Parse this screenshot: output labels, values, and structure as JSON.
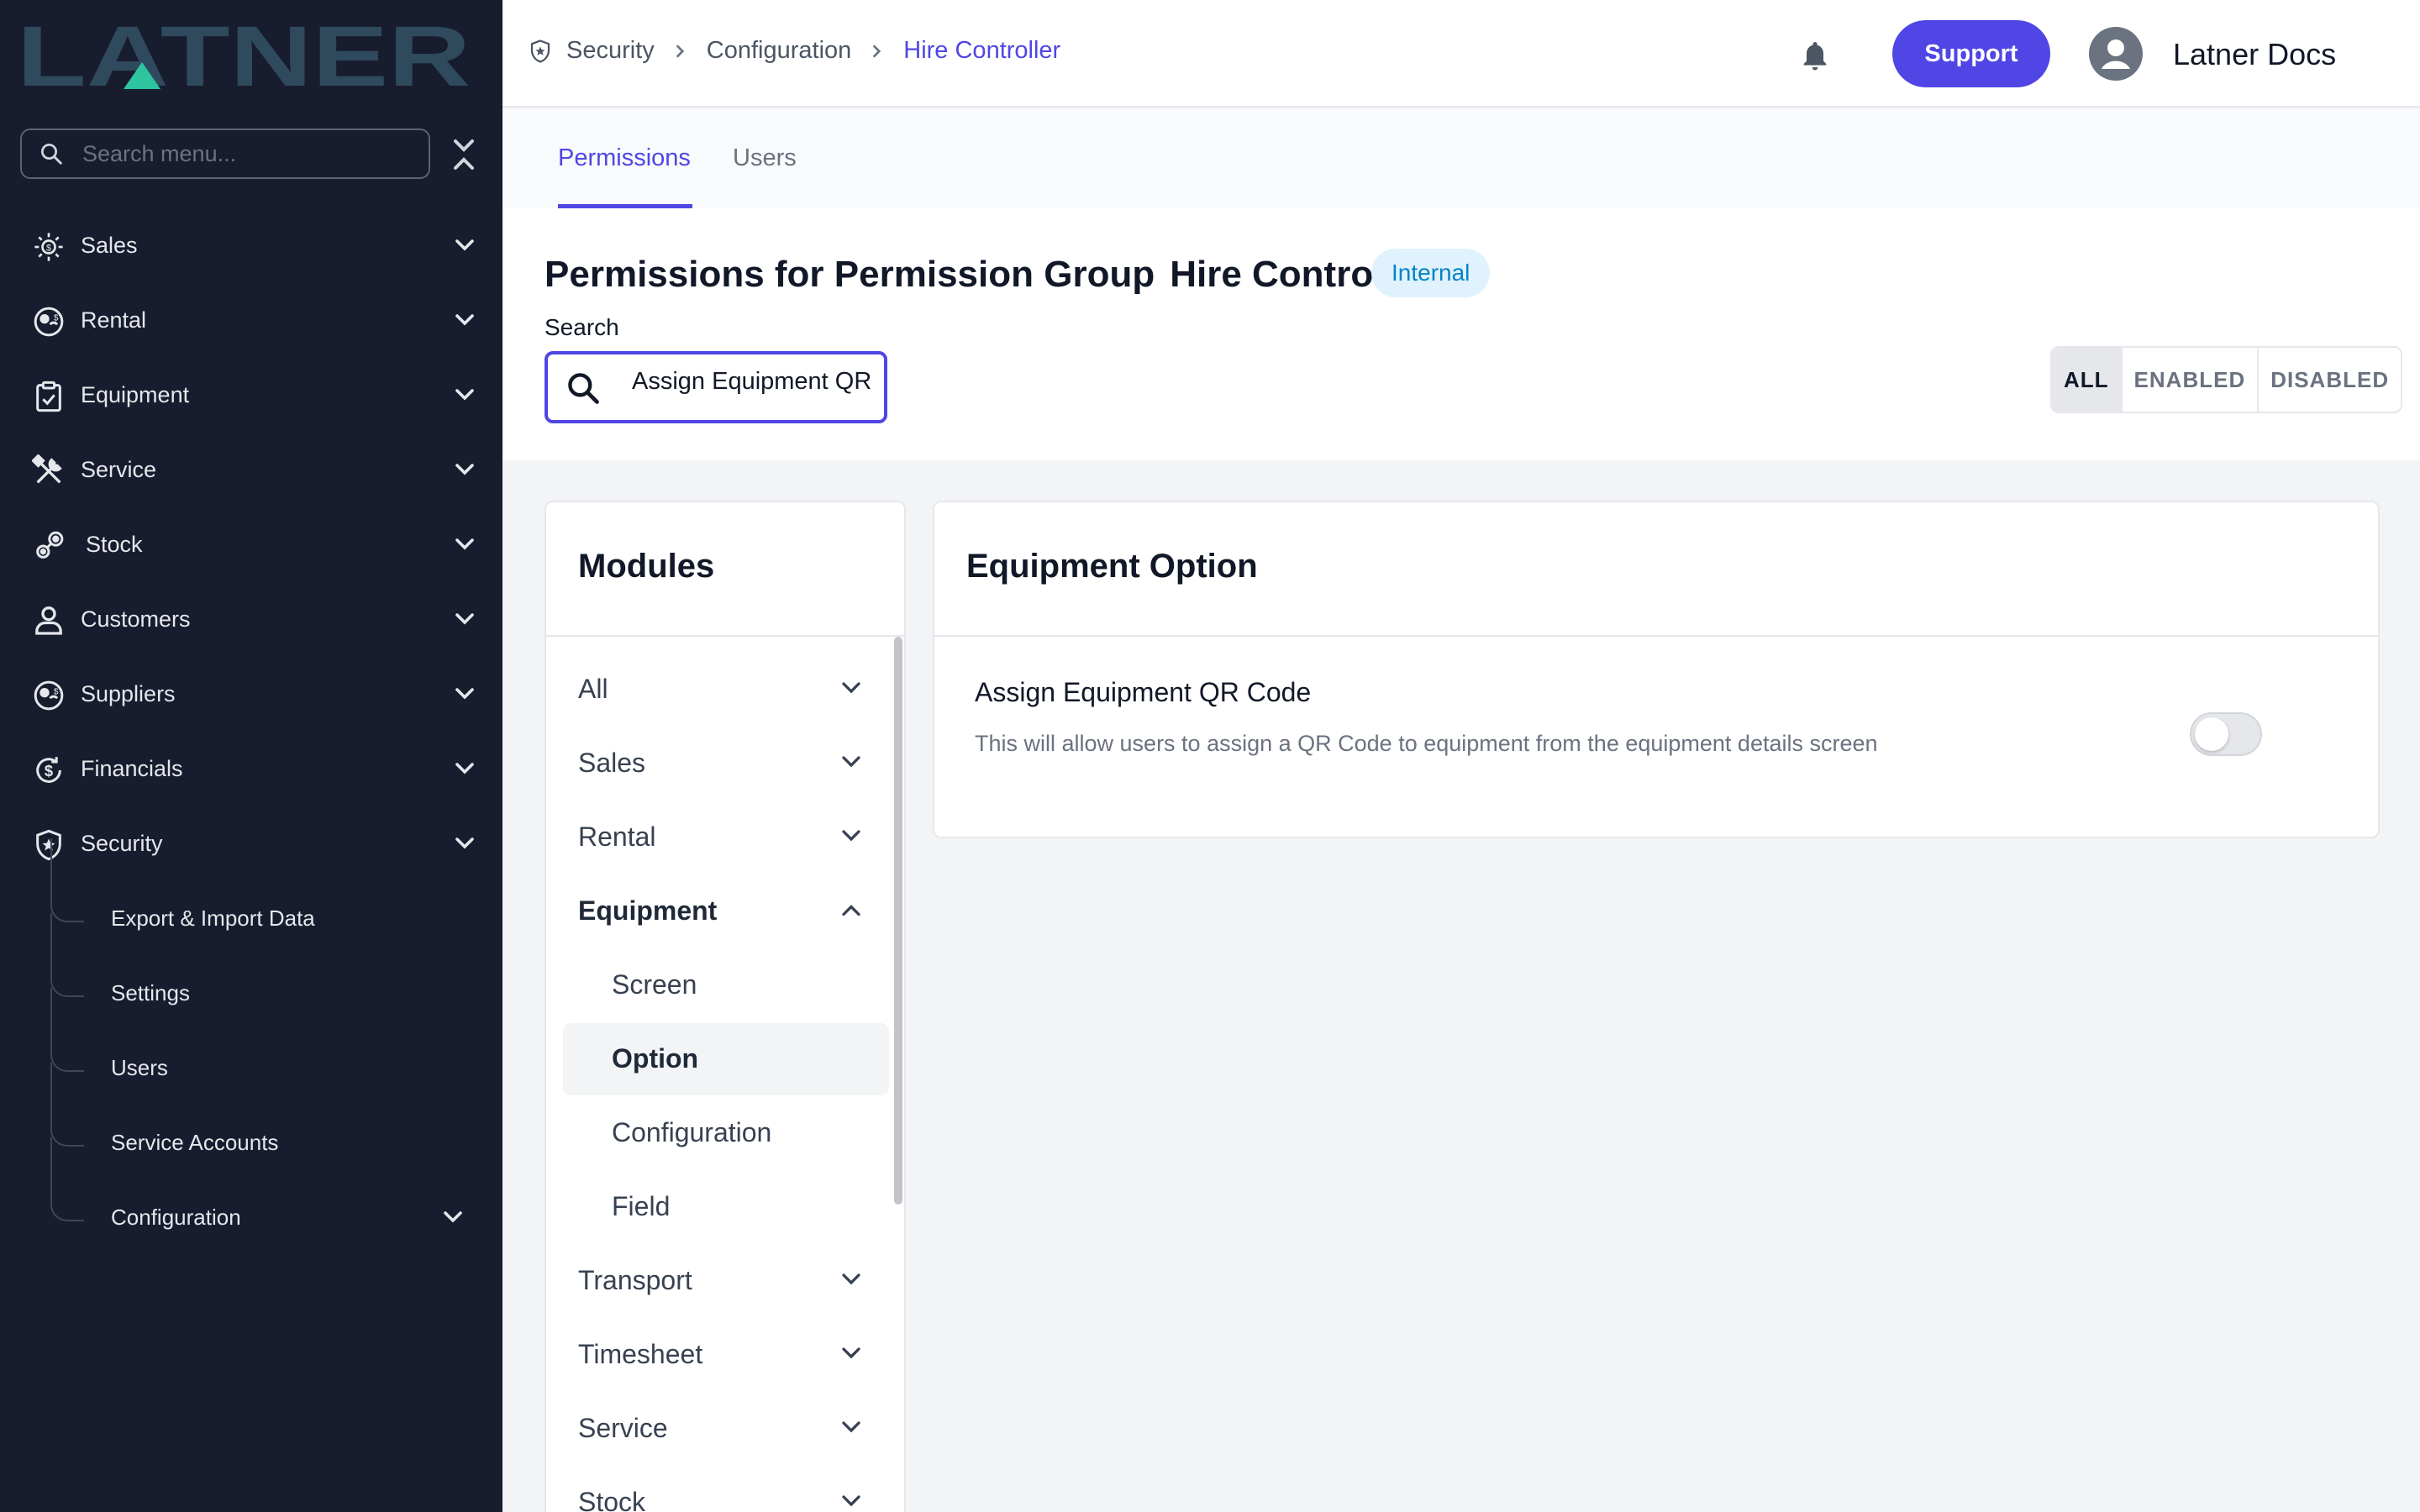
{
  "brand": {
    "logo_text": "LATNER"
  },
  "sidebar": {
    "search_placeholder": "Search menu...",
    "items": [
      {
        "label": "Sales",
        "icon": "sales-icon"
      },
      {
        "label": "Rental",
        "icon": "rental-icon"
      },
      {
        "label": "Equipment",
        "icon": "clipboard-icon"
      },
      {
        "label": "Service",
        "icon": "tools-icon"
      },
      {
        "label": "Stock",
        "icon": "gears-icon"
      },
      {
        "label": "Customers",
        "icon": "person-icon"
      },
      {
        "label": "Suppliers",
        "icon": "supplier-icon"
      },
      {
        "label": "Financials",
        "icon": "dollar-icon"
      },
      {
        "label": "Security",
        "icon": "shield-icon"
      }
    ],
    "security_sub": [
      {
        "label": "Export & Import Data"
      },
      {
        "label": "Settings"
      },
      {
        "label": "Users"
      },
      {
        "label": "Service Accounts"
      },
      {
        "label": "Configuration"
      }
    ]
  },
  "topbar": {
    "breadcrumb": [
      "Security",
      "Configuration",
      "Hire Controller"
    ],
    "support_label": "Support",
    "user_name": "Latner Docs"
  },
  "tabs": [
    {
      "label": "Permissions",
      "active": true
    },
    {
      "label": "Users",
      "active": false
    }
  ],
  "header": {
    "title_prefix": "Permissions for Permission Group",
    "group_name": "Hire Controller",
    "badge": "Internal",
    "search_label": "Search",
    "search_value": "Assign Equipment QR",
    "filters": [
      {
        "label": "ALL",
        "active": true
      },
      {
        "label": "ENABLED",
        "active": false
      },
      {
        "label": "DISABLED",
        "active": false
      }
    ]
  },
  "modules": {
    "title": "Modules",
    "items": [
      {
        "label": "All"
      },
      {
        "label": "Sales"
      },
      {
        "label": "Rental"
      },
      {
        "label": "Equipment",
        "expanded": true
      },
      {
        "label": "Transport"
      },
      {
        "label": "Timesheet"
      },
      {
        "label": "Service"
      },
      {
        "label": "Stock"
      }
    ],
    "equipment_sub": [
      {
        "label": "Screen"
      },
      {
        "label": "Option",
        "active": true
      },
      {
        "label": "Configuration"
      },
      {
        "label": "Field"
      }
    ]
  },
  "permission_panel": {
    "title": "Equipment Option",
    "permission": {
      "name": "Assign Equipment QR Code",
      "description": "This will allow users to assign a QR Code to equipment from the equipment details screen",
      "enabled": false
    }
  },
  "colors": {
    "accent": "#4f46e5",
    "sidebar_bg": "#171c2e",
    "logo": "#2e4a5c",
    "logo_accent": "#2ec4a0",
    "badge_bg": "#e0f2fe",
    "badge_text": "#0284c7"
  }
}
